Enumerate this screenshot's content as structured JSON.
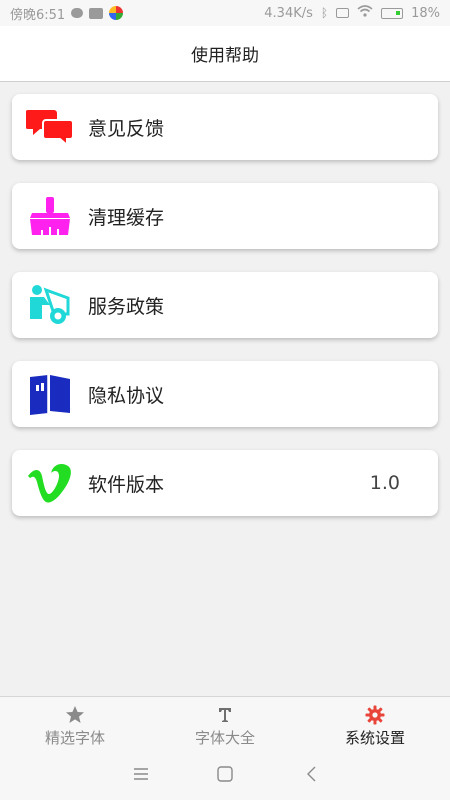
{
  "status_bar": {
    "time": "傍晚6:51",
    "speed": "4.34K/s",
    "battery": "18%"
  },
  "header": {
    "title": "使用帮助"
  },
  "menu": [
    {
      "label": "意见反馈",
      "icon": "feedback-icon",
      "color": "#ff1a1a"
    },
    {
      "label": "清理缓存",
      "icon": "broom-icon",
      "color": "#ff22ee"
    },
    {
      "label": "服务政策",
      "icon": "service-icon",
      "color": "#20d8d8"
    },
    {
      "label": "隐私协议",
      "icon": "book-icon",
      "color": "#1a2bbf"
    },
    {
      "label": "软件版本",
      "icon": "vimeo-v-icon",
      "color": "#22dd22",
      "value": "1.0"
    }
  ],
  "bottom_nav": [
    {
      "label": "精选字体",
      "icon": "star-icon",
      "active": false
    },
    {
      "label": "字体大全",
      "icon": "text-t-icon",
      "active": false
    },
    {
      "label": "系统设置",
      "icon": "gear-icon",
      "active": true,
      "color": "#e8443a"
    }
  ],
  "system_nav": [
    "menu-icon",
    "home-icon",
    "back-icon"
  ]
}
